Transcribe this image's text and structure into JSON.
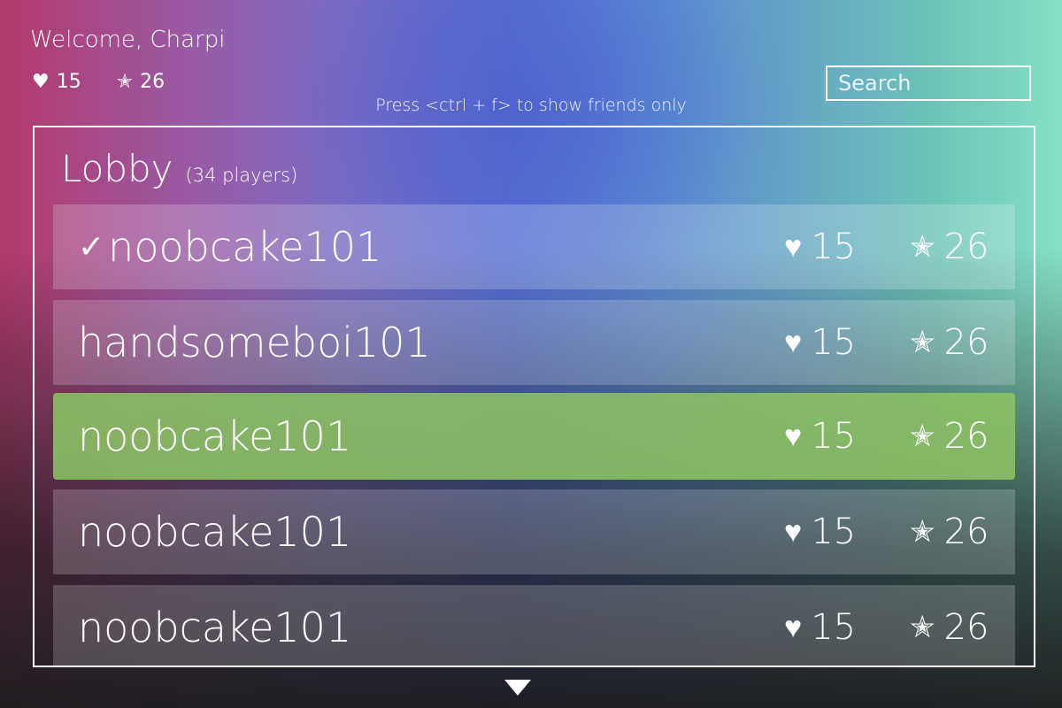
{
  "header": {
    "welcome": "Welcome, Charpi",
    "hearts": "15",
    "stars": "26"
  },
  "search": {
    "placeholder": "Search"
  },
  "hint": "Press <ctrl + f> to show friends only",
  "lobby": {
    "title": "Lobby",
    "count": "(34 players)"
  },
  "players": [
    {
      "name": "noobcake101",
      "hearts": "15",
      "stars": "26",
      "check": "✓"
    },
    {
      "name": "handsomeboi101",
      "hearts": "15",
      "stars": "26"
    },
    {
      "name": "noobcake101",
      "hearts": "15",
      "stars": "26",
      "selected": true
    },
    {
      "name": "noobcake101",
      "hearts": "15",
      "stars": "26"
    },
    {
      "name": "noobcake101",
      "hearts": "15",
      "stars": "26"
    }
  ],
  "icons": {
    "heart": "heart-icon",
    "star": "star-icon",
    "scroll": "chevron-down-icon"
  },
  "colors": {
    "selected_row": "#8cc364"
  }
}
